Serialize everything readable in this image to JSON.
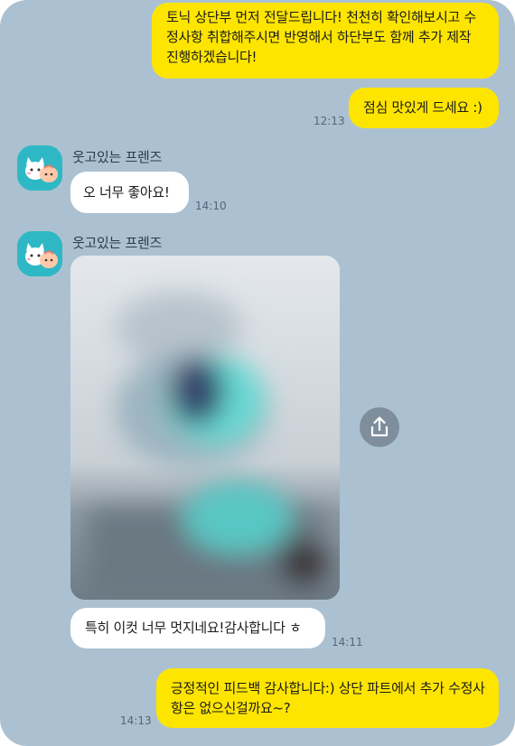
{
  "messages": {
    "m1": {
      "text": "토닉 상단부 먼저 전달드립니다! 천천히 확인해보시고 수정사항 취합해주시면 반영해서 하단부도 함께 추가 제작 진행하겠습니다!"
    },
    "m2": {
      "text": "점심 맛있게 드세요 :)",
      "time": "12:13"
    },
    "m3": {
      "sender": "웃고있는 프렌즈",
      "text": "오 너무 좋아요!",
      "time": "14:10"
    },
    "m4": {
      "sender": "웃고있는 프렌즈"
    },
    "m5": {
      "text": "특히 이컷 너무 멋지네요!감사합니다 ㅎ",
      "time": "14:11"
    },
    "m6": {
      "text": "긍정적인 피드백 감사합니다:) 상단 파트에서 추가 수정사항은 없으신걸까요~?",
      "time": "14:13"
    }
  },
  "icons": {
    "share": "upload-share-icon",
    "avatar": "kakao-friends-avatar-icon"
  },
  "colors": {
    "background": "#abc1d1",
    "my_bubble": "#fee500",
    "other_bubble": "#ffffff",
    "share_button": "#7f8e9c",
    "avatar_bg": "#2eb8c5"
  }
}
